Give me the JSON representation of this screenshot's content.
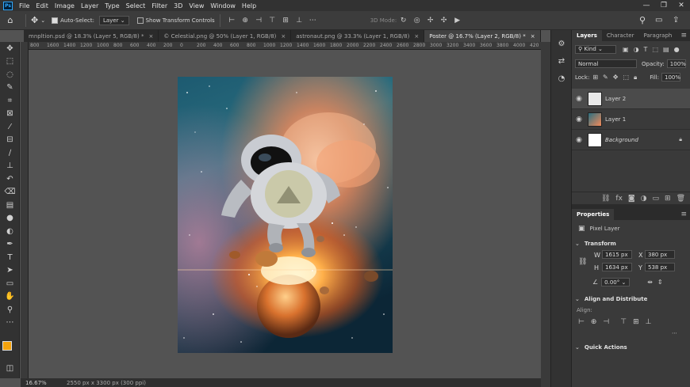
{
  "menubar": {
    "logo": "Ps",
    "items": [
      "File",
      "Edit",
      "Image",
      "Layer",
      "Type",
      "Select",
      "Filter",
      "3D",
      "View",
      "Window",
      "Help"
    ]
  },
  "options": {
    "auto_select_label": "Auto-Select:",
    "auto_select_value": "Layer",
    "show_transform_label": "Show Transform Controls",
    "mode_3d_label": "3D Mode:"
  },
  "tabs": [
    {
      "label": "mnpltion.psd @ 18.3% (Layer 5, RGB/8) *",
      "close": "×"
    },
    {
      "label": "© Celestial.png @ 50% (Layer 1, RGB/8)",
      "close": "×"
    },
    {
      "label": "astronaut.png @ 33.3% (Layer 1, RGB/8)",
      "close": "×"
    },
    {
      "label": "Poster @ 16.7% (Layer 2, RGB/8) *",
      "close": "×"
    }
  ],
  "ruler_ticks": [
    "800",
    "1600",
    "1400",
    "1200",
    "1000",
    "800",
    "600",
    "400",
    "200",
    "0",
    "200",
    "400",
    "600",
    "800",
    "1000",
    "1200",
    "1400",
    "1600",
    "1800",
    "2000",
    "2200",
    "2400",
    "2600",
    "2800",
    "3000",
    "3200",
    "3400",
    "3600",
    "3800",
    "4000",
    "420"
  ],
  "status": {
    "zoom": "16.67%",
    "doc_info": "2550 px x 3300 px (300 ppi)"
  },
  "layers_panel": {
    "tabs": [
      "Layers",
      "Character",
      "Paragraph"
    ],
    "filter_kind": "Kind",
    "blend_mode": "Normal",
    "opacity_label": "Opacity:",
    "opacity_value": "100%",
    "lock_label": "Lock:",
    "fill_label": "Fill:",
    "fill_value": "100%",
    "layers": [
      {
        "name": "Layer 2"
      },
      {
        "name": "Layer 1"
      },
      {
        "name": "Background"
      }
    ]
  },
  "properties_panel": {
    "title": "Properties",
    "layer_type": "Pixel Layer",
    "transform_title": "Transform",
    "w_label": "W",
    "w_value": "1615 px",
    "h_label": "H",
    "h_value": "1634 px",
    "x_label": "X",
    "x_value": "380 px",
    "y_label": "Y",
    "y_value": "538 px",
    "angle_value": "0.00°",
    "align_title": "Align and Distribute",
    "align_label": "Align:",
    "quick_actions_title": "Quick Actions"
  },
  "colors": {
    "foreground": "#f5a30d",
    "background": "#000000",
    "accent": "#31a8ff"
  }
}
